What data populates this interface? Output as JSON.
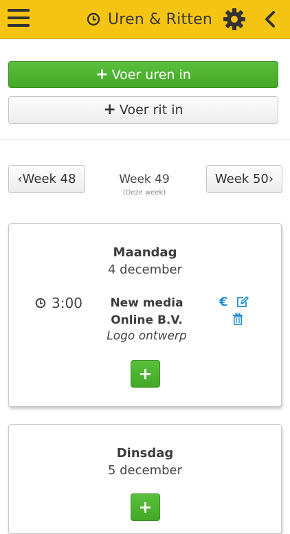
{
  "header": {
    "title": "Uren & Ritten",
    "background": "#f5c412",
    "icons": [
      "menu-icon",
      "clock-icon",
      "gear-icon",
      "chevron-left-icon"
    ]
  },
  "actions": {
    "add_hours_label": "Voer uren in",
    "add_ride_label": "Voer rit in",
    "plus_glyph": "+"
  },
  "week_nav": {
    "prev_label": "Week 48",
    "current_label": "Week 49",
    "current_sub": "(Deze week)",
    "next_label": "Week 50",
    "prev_chevron": "‹",
    "next_chevron": "›"
  },
  "days": [
    {
      "name": "Maandag",
      "date": "4 december",
      "entries": [
        {
          "duration": "3:00",
          "client": "New media Online B.V.",
          "description": "Logo ontwerp",
          "euro_glyph": "€"
        }
      ]
    },
    {
      "name": "Dinsdag",
      "date": "5 december",
      "entries": []
    }
  ],
  "colors": {
    "accent_green": "#44a827",
    "link_blue": "#1e8ed6"
  }
}
